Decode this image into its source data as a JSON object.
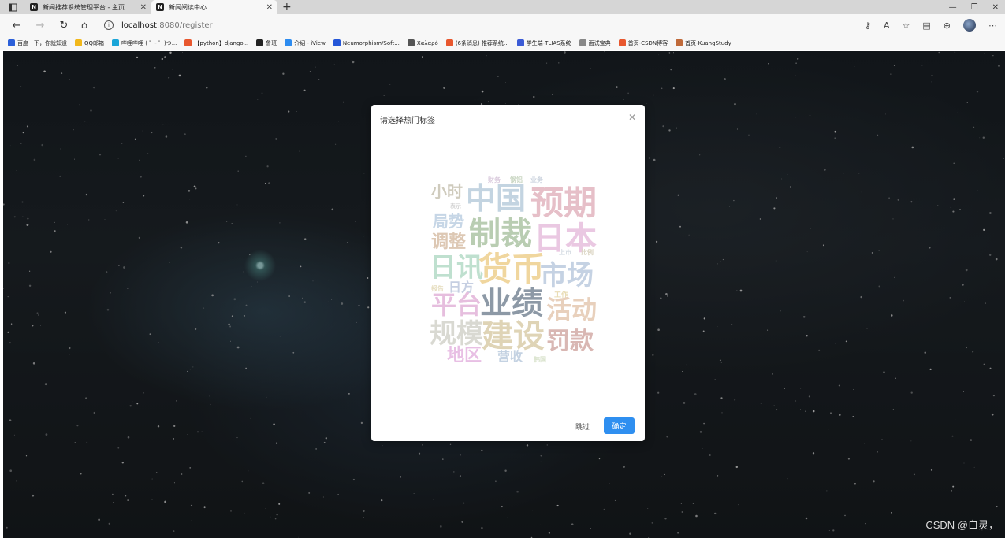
{
  "browser": {
    "tabs": [
      {
        "title": "新闻推荐系统管理平台 - 主页",
        "favicon": "N",
        "active": false
      },
      {
        "title": "新闻阅读中心",
        "favicon": "N",
        "active": true
      }
    ],
    "new_tab": "+",
    "url_host": "localhost",
    "url_path": ":8080/register",
    "bookmarks": [
      {
        "label": "百度一下，你就知道",
        "color": "#2b5fd9"
      },
      {
        "label": "QQ邮箱",
        "color": "#f2b81b"
      },
      {
        "label": "哔哩哔哩 ( ゜- ゜)つ...",
        "color": "#1aa5d8"
      },
      {
        "label": "【python】django...",
        "color": "#e8572e"
      },
      {
        "label": "鲁班",
        "color": "#222222"
      },
      {
        "label": "介绍 - iView",
        "color": "#2d8cf0"
      },
      {
        "label": "Neumorphism/Soft...",
        "color": "#2456d8"
      },
      {
        "label": "Χαλαρό",
        "color": "#555555"
      },
      {
        "label": "(6条消息) 推荐系统...",
        "color": "#e8572e"
      },
      {
        "label": "学生端-TLIAS系统",
        "color": "#3b5bd6"
      },
      {
        "label": "面试宝典",
        "color": "#888888"
      },
      {
        "label": "首页-CSDN博客",
        "color": "#e8572e"
      },
      {
        "label": "首页-KuangStudy",
        "color": "#c06a3a"
      }
    ]
  },
  "dialog": {
    "title": "请选择热门标签",
    "skip_label": "跳过",
    "confirm_label": "确定"
  },
  "tags": [
    {
      "text": "财务",
      "color": "#d9c9dc"
    },
    {
      "text": "钢铝",
      "color": "#c9d6c2"
    },
    {
      "text": "业务",
      "color": "#cbd3de"
    },
    {
      "text": "小时",
      "color": "#cfcbbd"
    },
    {
      "text": "中国",
      "color": "#c3d4e1"
    },
    {
      "text": "预期",
      "color": "#e6bfc8"
    },
    {
      "text": "表示",
      "color": "#d4d4d4"
    },
    {
      "text": "局势",
      "color": "#c6d6e6"
    },
    {
      "text": "制裁",
      "color": "#b9cdb2"
    },
    {
      "text": "日本",
      "color": "#eac8e2"
    },
    {
      "text": "调整",
      "color": "#ddc8b4"
    },
    {
      "text": "上市",
      "color": "#d6dde4"
    },
    {
      "text": "比例",
      "color": "#dcd6c4"
    },
    {
      "text": "日讯",
      "color": "#bfe0cf"
    },
    {
      "text": "货币",
      "color": "#f0d69e"
    },
    {
      "text": "市场",
      "color": "#c5d2e3"
    },
    {
      "text": "报告",
      "color": "#e5dcbc"
    },
    {
      "text": "日方",
      "color": "#c6cfe2"
    },
    {
      "text": "工作",
      "color": "#e9ddb6"
    },
    {
      "text": "平台",
      "color": "#e6bede"
    },
    {
      "text": "业绩",
      "color": "#8d99a6"
    },
    {
      "text": "活动",
      "color": "#e8d0bc"
    },
    {
      "text": "规模",
      "color": "#d9d9d2"
    },
    {
      "text": "建设",
      "color": "#dfd4b6"
    },
    {
      "text": "罚款",
      "color": "#d9b7b3"
    },
    {
      "text": "地区",
      "color": "#e8bfe4"
    },
    {
      "text": "营收",
      "color": "#c4d2e2"
    },
    {
      "text": "韩国",
      "color": "#d8e2cb"
    }
  ],
  "watermark": "CSDN @白灵，"
}
